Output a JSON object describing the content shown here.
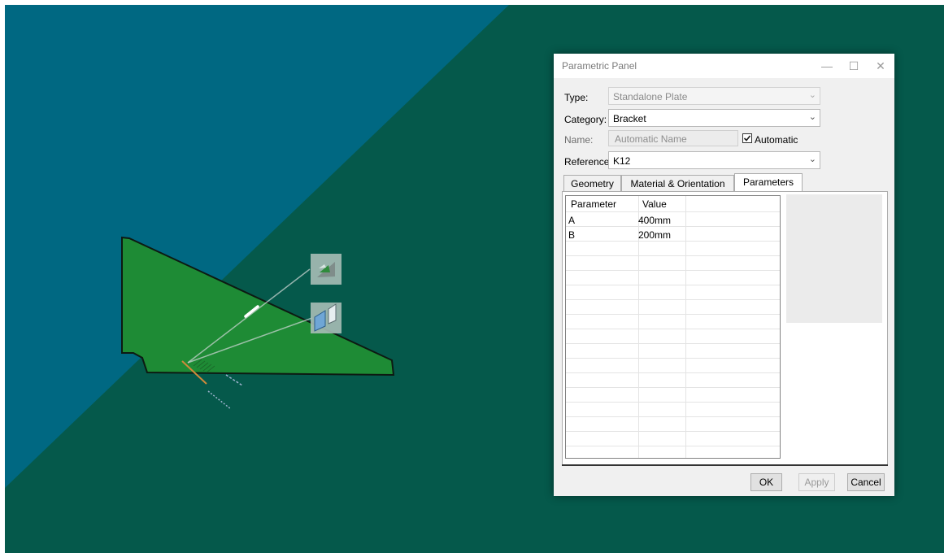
{
  "dialog": {
    "title": "Parametric Panel",
    "window_controls": [
      "minimize-icon",
      "maximize-icon",
      "close-icon"
    ],
    "type": {
      "label": "Type:",
      "value": "Standalone Plate",
      "disabled": true
    },
    "category": {
      "label": "Category:",
      "value": "Bracket"
    },
    "name": {
      "label": "Name:",
      "value": "Automatic Name",
      "automatic_checked": true,
      "automatic_label": "Automatic"
    },
    "reference": {
      "label": "Reference:",
      "value": "K12"
    },
    "tabs": [
      {
        "label": "Geometry",
        "active": false
      },
      {
        "label": "Material & Orientation",
        "active": false
      },
      {
        "label": "Parameters",
        "active": true
      }
    ],
    "table": {
      "headers": [
        "Parameter",
        "Value"
      ],
      "rows": [
        {
          "parameter": "A",
          "value": "400mm"
        },
        {
          "parameter": "B",
          "value": "200mm"
        }
      ]
    },
    "buttons": {
      "ok": "OK",
      "apply": "Apply",
      "cancel": "Cancel"
    }
  },
  "viewport": {
    "colors": {
      "upper_region": "#006882",
      "lower_region": "#05594b",
      "plate": "#1e8b35"
    },
    "gizmo_icons": [
      "bend-plate-icon",
      "plane-orientation-icon"
    ]
  }
}
